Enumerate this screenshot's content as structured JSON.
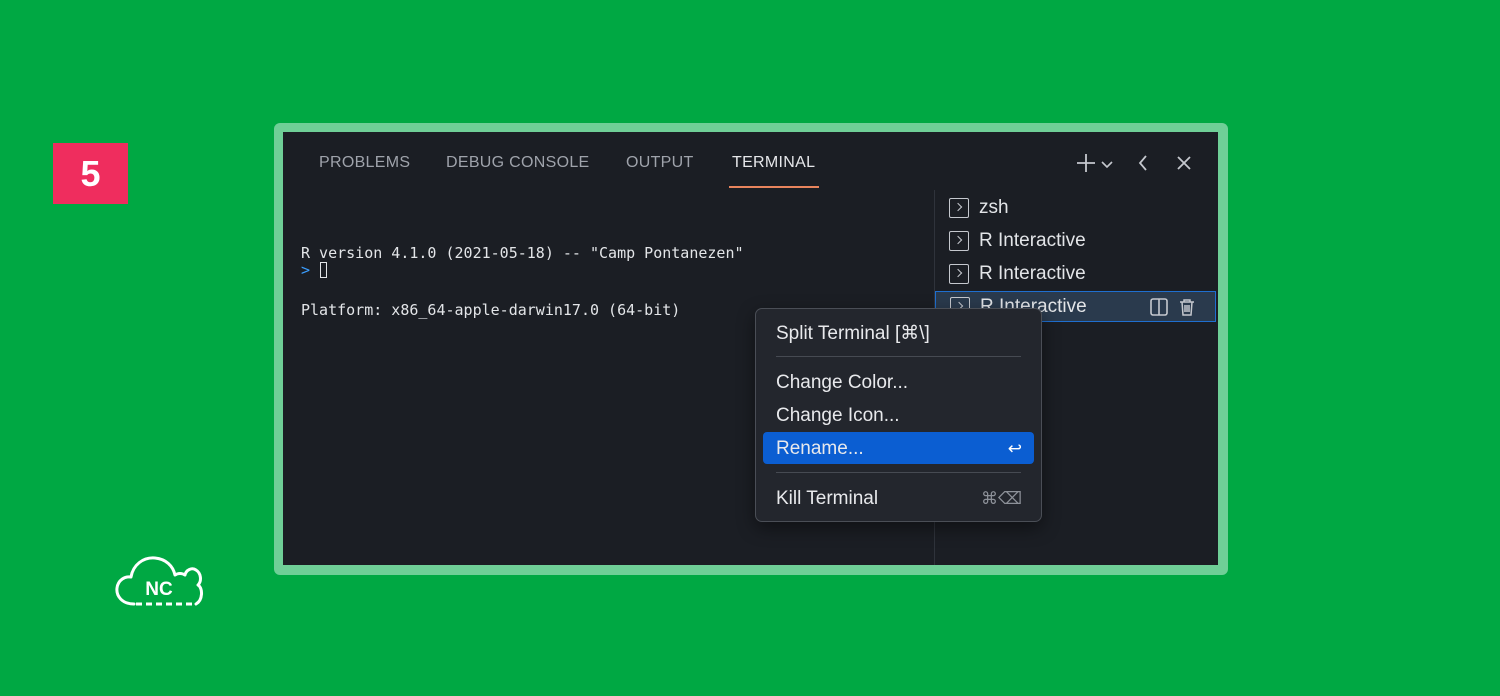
{
  "step": {
    "number": "5"
  },
  "logo": {
    "text": "NC"
  },
  "tabs": [
    {
      "label": "PROBLEMS",
      "active": false
    },
    {
      "label": "DEBUG CONSOLE",
      "active": false
    },
    {
      "label": "OUTPUT",
      "active": false
    },
    {
      "label": "TERMINAL",
      "active": true
    }
  ],
  "toolbar_icons": [
    "plus-icon",
    "chevron-down-icon",
    "chevron-left-icon",
    "close-icon"
  ],
  "terminal": {
    "lines": [
      "R version 4.1.0 (2021-05-18) -- \"Camp Pontanezen\"",
      "Platform: x86_64-apple-darwin17.0 (64-bit)"
    ],
    "prompt": ">"
  },
  "terminal_list": [
    {
      "label": "zsh",
      "selected": false
    },
    {
      "label": "R Interactive",
      "selected": false
    },
    {
      "label": "R Interactive",
      "selected": false
    },
    {
      "label": "R Interactive",
      "selected": true
    }
  ],
  "row_action_icons": [
    "split-icon",
    "trash-icon"
  ],
  "context_menu": {
    "items": [
      {
        "label": "Split Terminal [⌘\\]",
        "shortcut": ""
      },
      {
        "label": "Change Color...",
        "shortcut": ""
      },
      {
        "label": "Change Icon...",
        "shortcut": ""
      },
      {
        "label": "Rename...",
        "shortcut": "↩",
        "highlighted": true
      },
      {
        "label": "Kill Terminal",
        "shortcut": "⌘⌫"
      }
    ]
  },
  "colors": {
    "background": "#00a843",
    "badge": "#ef2d5e",
    "frame": "#6fcf97",
    "panel": "#1b1e24",
    "tab_underline": "#e8845d",
    "menu_highlight": "#0b5ed2",
    "prompt": "#3b9eff"
  }
}
